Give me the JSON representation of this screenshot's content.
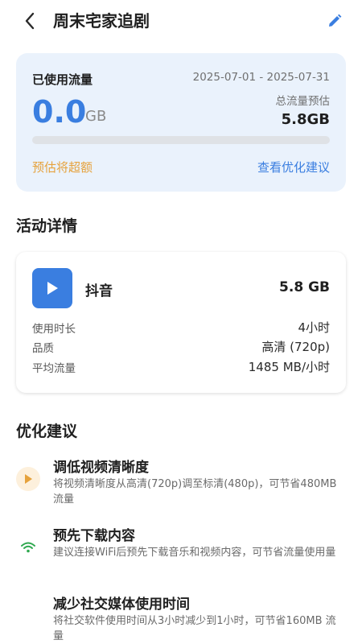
{
  "header": {
    "title": "周末宅家追剧",
    "back_icon": "chevron-left-icon",
    "edit_icon": "pencil-icon"
  },
  "usage": {
    "used_label": "已使用流量",
    "date_range": "2025-07-01 - 2025-07-31",
    "used_value": "0.0",
    "used_unit": "GB",
    "estimate_label": "总流量预估",
    "estimate_value": "5.8GB",
    "progress_fraction": 0,
    "warning": "预估将超额",
    "advice_link": "查看优化建议"
  },
  "activity": {
    "section_title": "活动详情",
    "app": {
      "icon": "play-icon",
      "name": "抖音",
      "usage": "5.8 GB"
    },
    "stats": [
      {
        "label": "使用时长",
        "value": "4小时"
      },
      {
        "label": "品质",
        "value": "高清 (720p)"
      },
      {
        "label": "平均流量",
        "value": "1485 MB/小时"
      }
    ]
  },
  "tips": {
    "section_title": "优化建议",
    "items": [
      {
        "icon": "play-icon",
        "title": "调低视频清晰度",
        "desc": "将视频清晰度从高清(720p)调至标清(480p)，可节省480MB 流量"
      },
      {
        "icon": "wifi-icon",
        "title": "预先下载内容",
        "desc": "建议连接WiFi后预先下载音乐和视频内容，可节省流量使用量"
      },
      {
        "icon": "",
        "title": "减少社交媒体使用时间",
        "desc": "将社交软件使用时间从3小时减少到1小时，可节省160MB 流量"
      }
    ]
  },
  "colors": {
    "accent": "#3a7ee0",
    "warning": "#e6a23c",
    "wifi": "#2fa84f",
    "card_bg": "#eaf2fc"
  }
}
